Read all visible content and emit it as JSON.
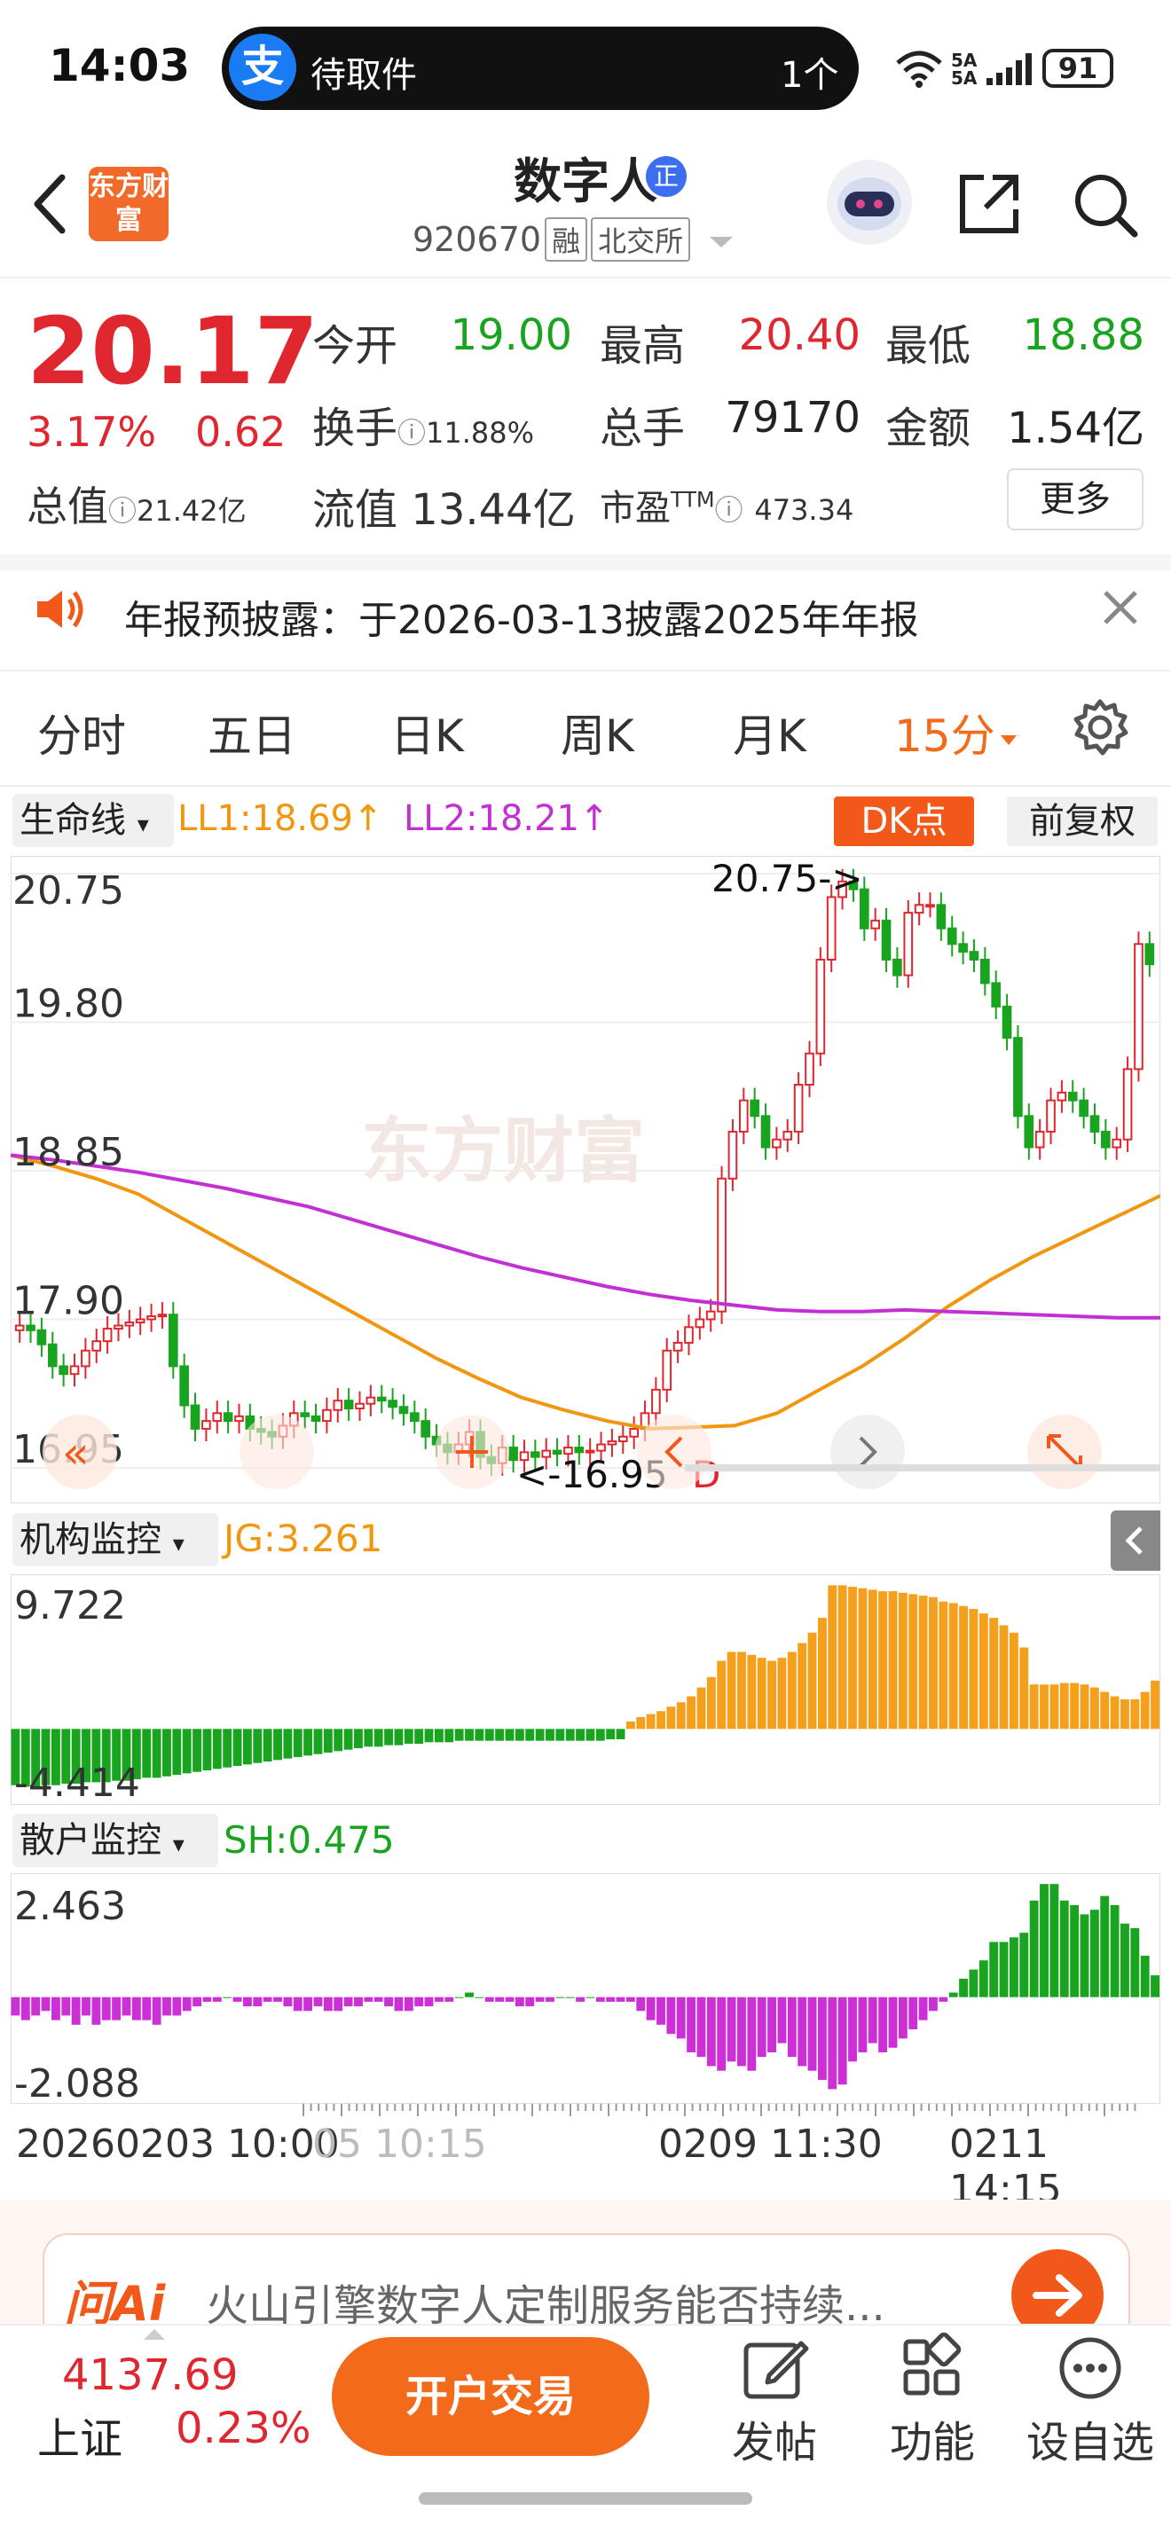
{
  "status_bar": {
    "time": "14:03",
    "notification_app": "支",
    "notification_text": "待取件",
    "notification_count": "1个",
    "network": "5A 5A",
    "battery": "91"
  },
  "header": {
    "app_logo": "东方财富",
    "stock_name": "数字人",
    "stock_badge": "正",
    "stock_code": "920670",
    "tag1": "融",
    "tag2": "北交所"
  },
  "quote": {
    "price": "20.17",
    "change_pct": "3.17%",
    "change": "0.62",
    "open_label": "今开",
    "open": "19.00",
    "high_label": "最高",
    "high": "20.40",
    "low_label": "最低",
    "low": "18.88",
    "turnover_label": "换手",
    "turnover": "11.88%",
    "volume_label": "总手",
    "volume": "79170",
    "amount_label": "金额",
    "amount": "1.54亿",
    "mcap_label": "总值",
    "mcap": "21.42亿",
    "float_label": "流值",
    "float_cap": "13.44亿",
    "pe_label": "市盈",
    "pe_sup": "TTM",
    "pe": "473.34",
    "more_button": "更多"
  },
  "notice": {
    "text": "年报预披露：于2026-03-13披露2025年年报"
  },
  "tabs": [
    "分时",
    "五日",
    "日K",
    "周K",
    "月K",
    "15分"
  ],
  "indicator": {
    "selector": "生命线",
    "ll1": "LL1:18.69↑",
    "ll2": "LL2:18.21↑",
    "dk_button": "DK点",
    "adjust_button": "前复权"
  },
  "chart_data": [
    {
      "type": "candlestick",
      "title": "",
      "y_ticks": [
        "20.75",
        "19.80",
        "18.85",
        "17.90",
        "16.95"
      ],
      "ylim": [
        16.95,
        20.75
      ],
      "x_ticks": [
        "20260203 10:00",
        "05 10:15",
        "0209 11:30",
        "0211 14:15"
      ],
      "annotations": [
        "20.75->",
        "<-16.95",
        "D"
      ],
      "series": [
        {
          "name": "LL1",
          "color": "#f0960f"
        },
        {
          "name": "LL2",
          "color": "#c22fd3"
        }
      ],
      "close": [
        17.86,
        17.83,
        17.74,
        17.6,
        17.55,
        17.6,
        17.7,
        17.76,
        17.84,
        17.86,
        17.88,
        17.9,
        17.92,
        17.93,
        17.6,
        17.35,
        17.2,
        17.25,
        17.3,
        17.25,
        17.28,
        17.2,
        17.18,
        17.15,
        17.22,
        17.3,
        17.28,
        17.25,
        17.32,
        17.38,
        17.33,
        17.36,
        17.4,
        17.38,
        17.34,
        17.3,
        17.25,
        17.15,
        17.1,
        17.05,
        17.1,
        17.18,
        17.02,
        16.98,
        17.08,
        17.0,
        17.05,
        17.02,
        17.06,
        17.04,
        17.08,
        17.05,
        17.06,
        17.1,
        17.12,
        17.15,
        17.2,
        17.3,
        17.45,
        17.7,
        17.75,
        17.85,
        17.9,
        17.95,
        18.8,
        19.1,
        19.3,
        19.2,
        19.0,
        19.05,
        19.1,
        19.4,
        19.6,
        20.2,
        20.6,
        20.7,
        20.65,
        20.4,
        20.45,
        20.2,
        20.1,
        20.5,
        20.55,
        20.55,
        20.4,
        20.3,
        20.25,
        20.2,
        20.05,
        19.9,
        19.7,
        19.2,
        19.0,
        19.1,
        19.3,
        19.35,
        19.3,
        19.2,
        19.1,
        19.0,
        19.05,
        19.5,
        20.3,
        20.17
      ],
      "ll1": [
        18.95,
        18.88,
        18.8,
        18.7,
        18.55,
        18.4,
        18.25,
        18.1,
        17.95,
        17.8,
        17.65,
        17.52,
        17.4,
        17.32,
        17.25,
        17.2,
        17.21,
        17.22,
        17.3,
        17.45,
        17.6,
        17.78,
        17.98,
        18.15,
        18.3,
        18.43,
        18.56,
        18.69
      ],
      "ll2": [
        18.95,
        18.92,
        18.88,
        18.84,
        18.79,
        18.74,
        18.68,
        18.62,
        18.54,
        18.46,
        18.38,
        18.3,
        18.23,
        18.17,
        18.11,
        18.06,
        18.02,
        17.99,
        17.96,
        17.95,
        17.95,
        17.96,
        17.95,
        17.94,
        17.93,
        17.92,
        17.91,
        17.91
      ]
    },
    {
      "type": "bar",
      "title": "机构监控",
      "value_label": "JG:3.261",
      "y_ticks": [
        "9.722",
        "-4.414"
      ],
      "ylim": [
        -4.414,
        9.722
      ],
      "values": [
        -3.8,
        -3.9,
        -3.9,
        -3.8,
        -3.8,
        -3.7,
        -3.7,
        -3.6,
        -3.6,
        -3.6,
        -3.5,
        -3.5,
        -3.4,
        -3.3,
        -3.3,
        -3.2,
        -3.1,
        -3.0,
        -2.9,
        -2.8,
        -2.7,
        -2.6,
        -2.5,
        -2.4,
        -2.3,
        -2.2,
        -2.1,
        -2.0,
        -1.9,
        -1.8,
        -1.7,
        -1.6,
        -1.5,
        -1.4,
        -1.3,
        -1.2,
        -1.2,
        -1.1,
        -1.1,
        -1.0,
        -1.0,
        -0.9,
        -0.9,
        -0.9,
        -0.8,
        -0.8,
        -0.8,
        -0.8,
        -0.8,
        -0.8,
        -0.8,
        -0.8,
        -0.8,
        -0.8,
        -0.8,
        -0.8,
        -0.8,
        -0.8,
        -0.8,
        -0.7,
        -0.7,
        0.5,
        0.8,
        1.0,
        1.2,
        1.5,
        1.8,
        2.2,
        2.8,
        3.5,
        4.6,
        5.2,
        5.2,
        5.0,
        4.8,
        4.6,
        4.8,
        5.2,
        5.8,
        6.5,
        7.5,
        9.7,
        9.7,
        9.6,
        9.5,
        9.4,
        9.3,
        9.3,
        9.2,
        9.1,
        9.0,
        8.9,
        8.6,
        8.5,
        8.3,
        8.1,
        7.8,
        7.5,
        7.0,
        6.5,
        5.5,
        3.0,
        3.0,
        3.0,
        3.1,
        3.1,
        3.0,
        2.8,
        2.5,
        2.2,
        2.0,
        2.0,
        2.5,
        3.261
      ]
    },
    {
      "type": "bar",
      "title": "散户监控",
      "value_label": "SH:0.475",
      "y_ticks": [
        "2.463",
        "-2.088"
      ],
      "ylim": [
        -2.088,
        2.463
      ],
      "values": [
        -0.4,
        -0.5,
        -0.4,
        -0.3,
        -0.5,
        -0.4,
        -0.6,
        -0.4,
        -0.6,
        -0.5,
        -0.5,
        -0.4,
        -0.5,
        -0.5,
        -0.6,
        -0.4,
        -0.4,
        -0.3,
        -0.2,
        -0.1,
        -0.1,
        0.0,
        -0.1,
        -0.2,
        -0.2,
        -0.1,
        -0.1,
        -0.2,
        -0.3,
        -0.3,
        -0.2,
        -0.3,
        -0.3,
        -0.2,
        -0.2,
        -0.1,
        -0.1,
        -0.2,
        -0.3,
        -0.3,
        -0.2,
        -0.2,
        -0.1,
        -0.1,
        0.0,
        0.1,
        0.0,
        -0.1,
        -0.1,
        -0.1,
        -0.2,
        -0.2,
        -0.1,
        -0.1,
        0.0,
        0.0,
        -0.1,
        0.0,
        -0.1,
        -0.1,
        -0.1,
        -0.1,
        -0.3,
        -0.5,
        -0.6,
        -0.8,
        -0.9,
        -1.2,
        -1.3,
        -1.5,
        -1.6,
        -1.4,
        -1.5,
        -1.6,
        -1.3,
        -1.2,
        -1.0,
        -1.3,
        -1.5,
        -1.6,
        -1.8,
        -2.0,
        -1.9,
        -1.4,
        -1.2,
        -1.0,
        -1.2,
        -1.1,
        -0.9,
        -0.7,
        -0.5,
        -0.3,
        -0.1,
        0.1,
        0.4,
        0.6,
        0.8,
        1.2,
        1.2,
        1.3,
        1.4,
        2.1,
        2.46,
        2.46,
        2.1,
        2.0,
        1.8,
        1.9,
        2.2,
        2.0,
        1.6,
        1.5,
        0.9,
        0.475
      ]
    }
  ],
  "inst_panel": {
    "selector": "机构监控",
    "value": "JG:3.261",
    "max": "9.722",
    "min": "-4.414"
  },
  "retail_panel": {
    "selector": "散户监控",
    "value": "SH:0.475",
    "max": "2.463",
    "min": "-2.088"
  },
  "main_panel": {
    "y_ticks": [
      "20.75",
      "19.80",
      "18.85",
      "17.90",
      "16.95"
    ],
    "high_label": "20.75->",
    "low_label": "<-16.95",
    "d_label": "D"
  },
  "x_axis": [
    "20260203 10:00",
    "05 10:15",
    "0209 11:30",
    "0211 14:15"
  ],
  "ai_bar": {
    "logo": "问Ai",
    "text": "火山引擎数字人定制服务能否持续..."
  },
  "bottom_bar": {
    "index_value": "4137.69",
    "index_name": "上证",
    "index_pct": "0.23%",
    "trade_button": "开户交易",
    "post": "发帖",
    "functions": "功能",
    "watchlist": "设自选"
  },
  "colors": {
    "up": "#e0262f",
    "down": "#19a41f",
    "accent": "#f26a1a",
    "ll1": "#f0960f",
    "ll2": "#c22fd3",
    "inst_pos": "#f5a01c",
    "retail_neg": "#cc2fd6"
  }
}
